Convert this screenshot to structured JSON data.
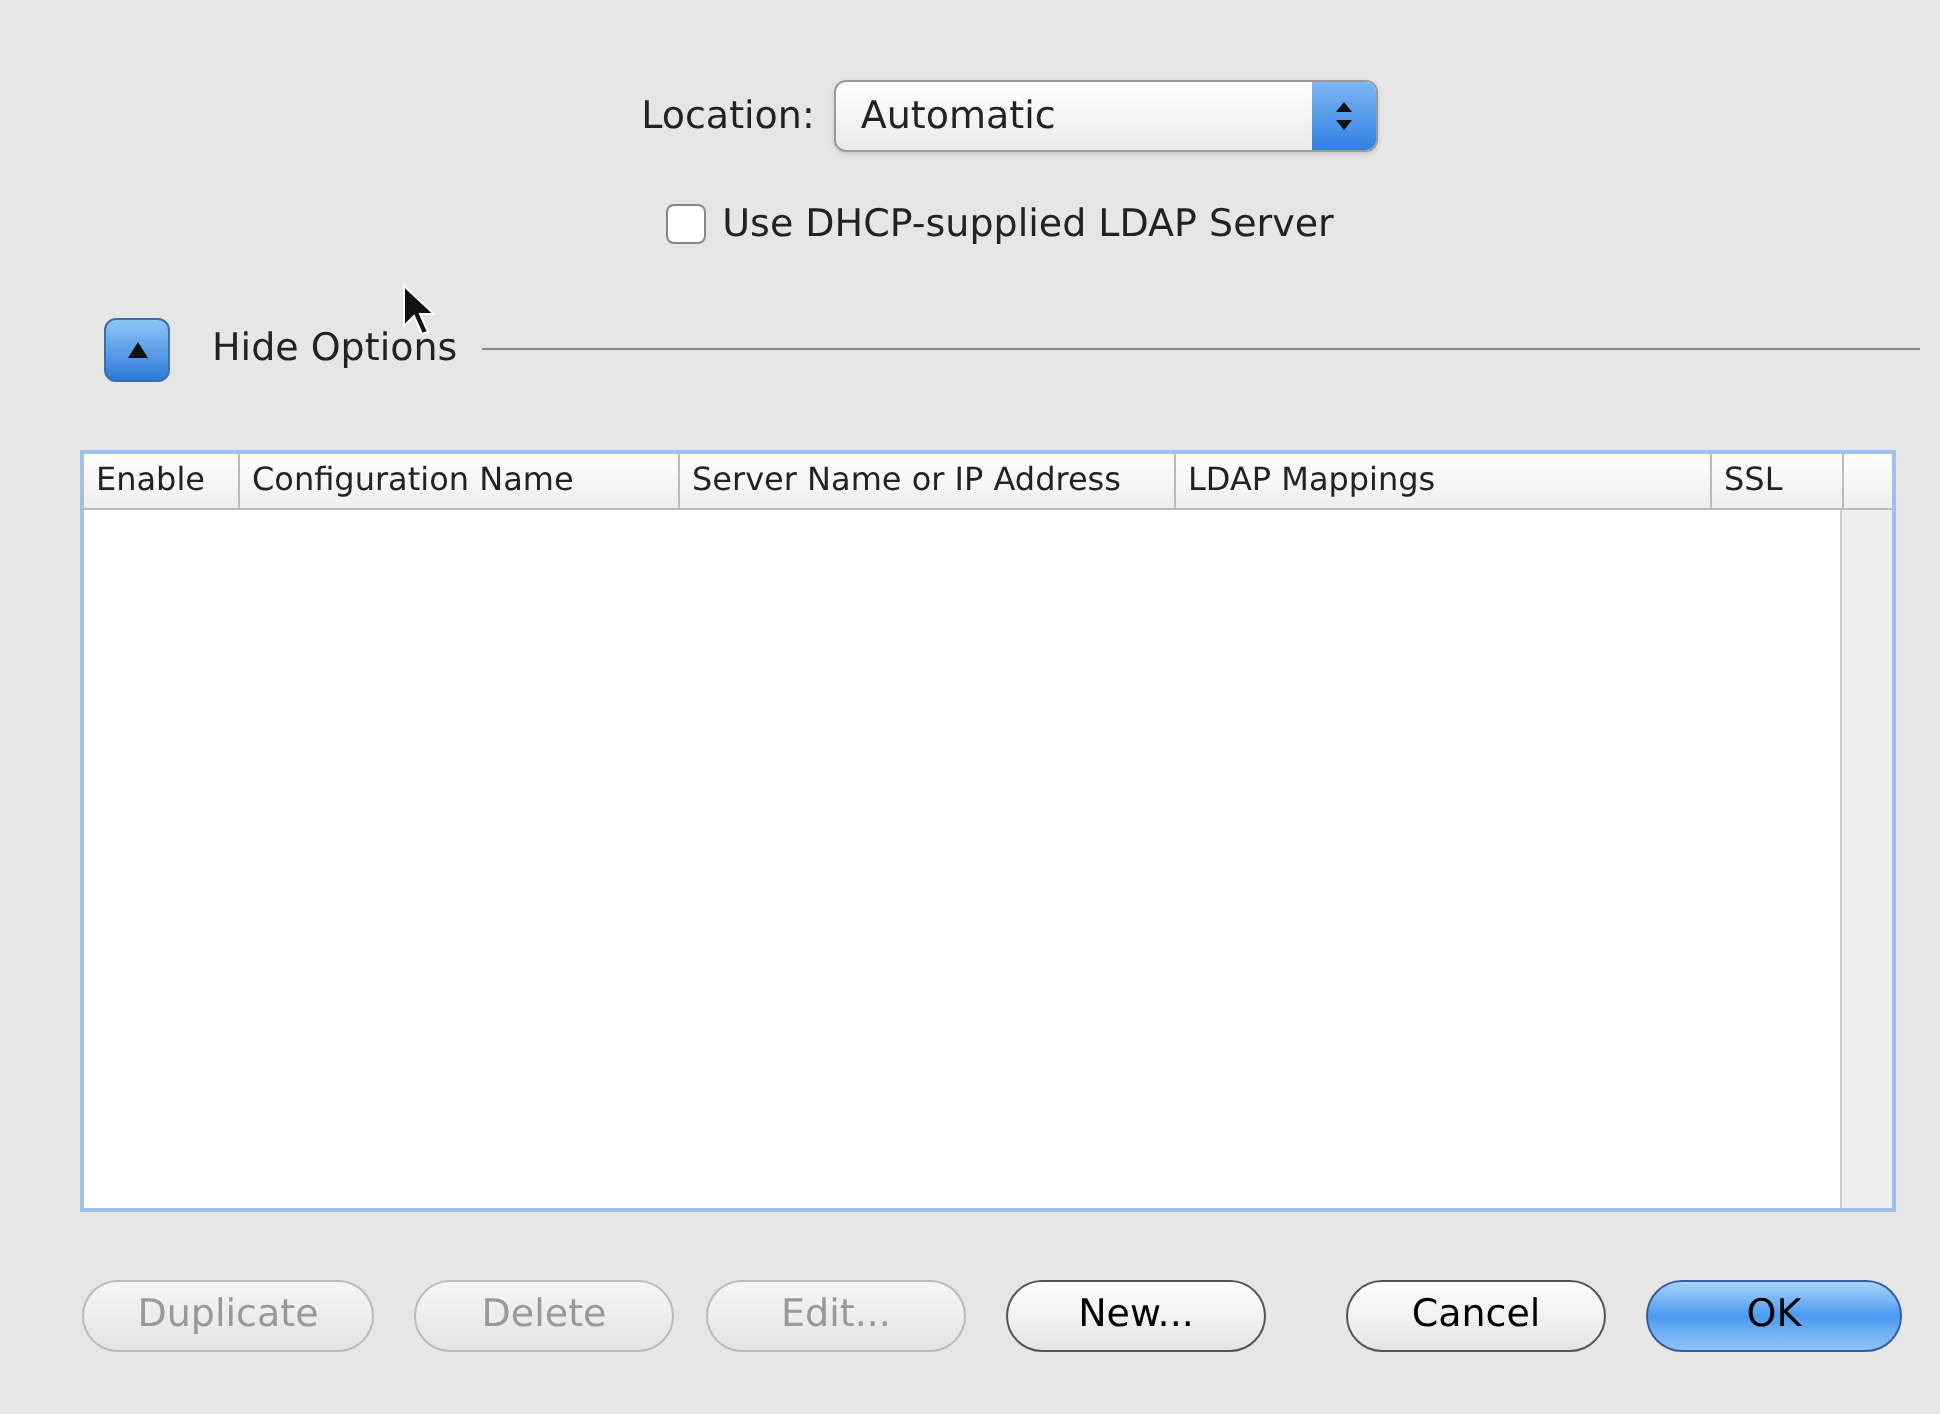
{
  "location": {
    "label": "Location:",
    "value": "Automatic"
  },
  "dhcp": {
    "label": "Use DHCP-supplied LDAP Server",
    "checked": false
  },
  "options": {
    "label": "Hide Options",
    "expanded": true
  },
  "table": {
    "columns": [
      "Enable",
      "Configuration Name",
      "Server Name or IP Address",
      "LDAP Mappings",
      "SSL"
    ]
  },
  "buttons": [
    {
      "label": "Duplicate",
      "disabled": true,
      "kind": "push"
    },
    {
      "label": "Delete",
      "disabled": true,
      "kind": "push"
    },
    {
      "label": "Edit...",
      "disabled": true,
      "kind": "push"
    },
    {
      "label": "New...",
      "disabled": false,
      "kind": "push"
    },
    {
      "label": "Cancel",
      "disabled": false,
      "kind": "push"
    },
    {
      "label": "OK",
      "disabled": false,
      "kind": "default"
    }
  ]
}
